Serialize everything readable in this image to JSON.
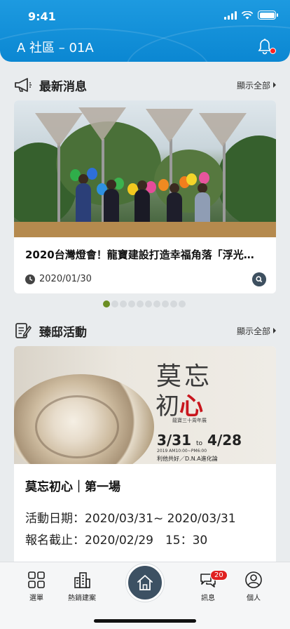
{
  "status": {
    "time": "9:41"
  },
  "header": {
    "community": "A 社區 – 01A"
  },
  "news": {
    "title": "最新消息",
    "more": "顯示全部",
    "item": {
      "title": "2020台灣燈會！龍寶建設打造幸福角落「浮光…",
      "date": "2020/01/30"
    },
    "pager": {
      "count": 10,
      "active": 0
    }
  },
  "events": {
    "title": "臻邸活動",
    "more": "顯示全部",
    "poster": {
      "title_line1": "莫忘",
      "title_line2a": "初",
      "title_line2b": "心",
      "subtitle": "龍寶三十周年展",
      "date_start": "3/31",
      "date_to": "to",
      "date_end": "4/28",
      "hours": "2019 AM10:00~PM6:00",
      "theme": "利他共好／D.N.A進化論"
    },
    "item": {
      "title": "莫忘初心｜第一場",
      "date_line": "活動日期：2020/03/31~ 2020/03/31",
      "deadline_line": "報名截止：2020/02/29　15：30"
    }
  },
  "tabbar": {
    "menu": "選單",
    "projects": "熱銷建案",
    "messages": "訊息",
    "messages_badge": "20",
    "profile": "個人"
  },
  "colors": {
    "header": "#0b87d2",
    "accent_dot": "#6b8e23",
    "home": "#3d5163",
    "badge": "#e02020"
  }
}
